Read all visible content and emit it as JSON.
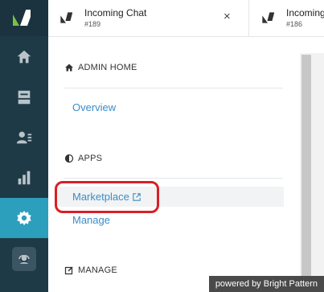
{
  "colors": {
    "rail": "#1e3a47",
    "active": "#2b9fbc",
    "link": "#3b8cc7",
    "callout": "#d81f26"
  },
  "rail": {
    "items": [
      {
        "icon": "home-icon"
      },
      {
        "icon": "inbox-icon"
      },
      {
        "icon": "contacts-icon"
      },
      {
        "icon": "reports-icon"
      },
      {
        "icon": "gear-icon",
        "active": true
      }
    ]
  },
  "tabs": [
    {
      "title": "Incoming Chat",
      "sub": "#189",
      "close": "×"
    },
    {
      "title": "Incoming",
      "sub": "#186"
    }
  ],
  "panel": {
    "admin_home": {
      "title": "ADMIN HOME",
      "links": [
        "Overview"
      ]
    },
    "apps": {
      "title": "APPS",
      "links": [
        "Marketplace",
        "Manage"
      ]
    },
    "manage": {
      "title": "MANAGE"
    }
  },
  "footer": {
    "powered": "powered by Bright Pattern"
  }
}
